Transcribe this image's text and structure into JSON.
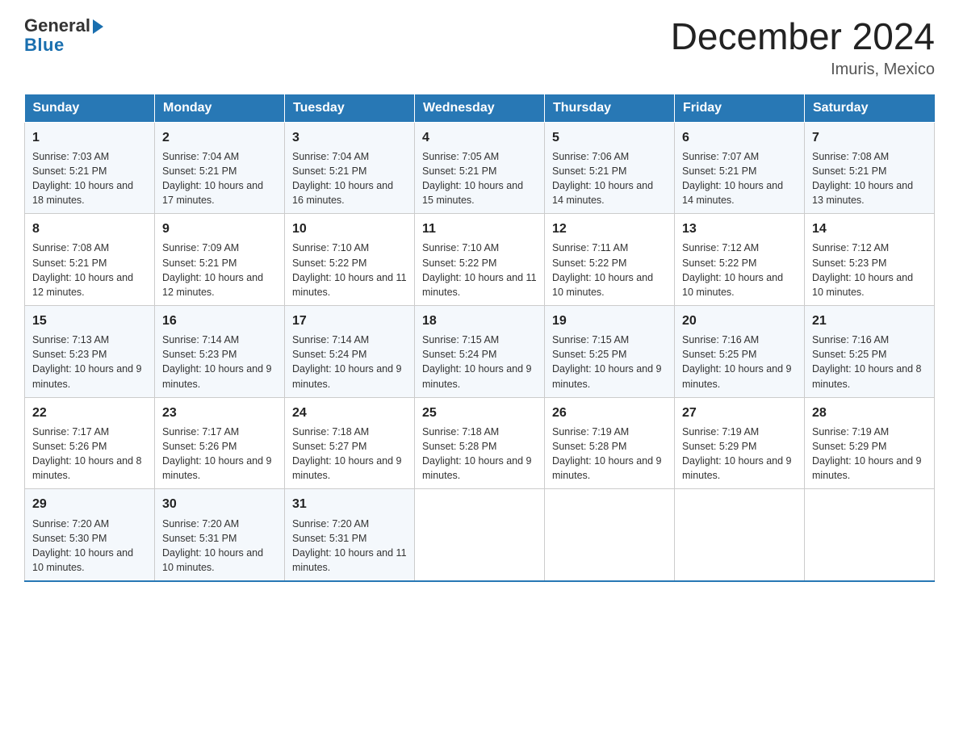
{
  "header": {
    "logo_text_general": "General",
    "logo_text_blue": "Blue",
    "month_title": "December 2024",
    "location": "Imuris, Mexico"
  },
  "days_of_week": [
    "Sunday",
    "Monday",
    "Tuesday",
    "Wednesday",
    "Thursday",
    "Friday",
    "Saturday"
  ],
  "weeks": [
    [
      {
        "day": "1",
        "sunrise": "Sunrise: 7:03 AM",
        "sunset": "Sunset: 5:21 PM",
        "daylight": "Daylight: 10 hours and 18 minutes."
      },
      {
        "day": "2",
        "sunrise": "Sunrise: 7:04 AM",
        "sunset": "Sunset: 5:21 PM",
        "daylight": "Daylight: 10 hours and 17 minutes."
      },
      {
        "day": "3",
        "sunrise": "Sunrise: 7:04 AM",
        "sunset": "Sunset: 5:21 PM",
        "daylight": "Daylight: 10 hours and 16 minutes."
      },
      {
        "day": "4",
        "sunrise": "Sunrise: 7:05 AM",
        "sunset": "Sunset: 5:21 PM",
        "daylight": "Daylight: 10 hours and 15 minutes."
      },
      {
        "day": "5",
        "sunrise": "Sunrise: 7:06 AM",
        "sunset": "Sunset: 5:21 PM",
        "daylight": "Daylight: 10 hours and 14 minutes."
      },
      {
        "day": "6",
        "sunrise": "Sunrise: 7:07 AM",
        "sunset": "Sunset: 5:21 PM",
        "daylight": "Daylight: 10 hours and 14 minutes."
      },
      {
        "day": "7",
        "sunrise": "Sunrise: 7:08 AM",
        "sunset": "Sunset: 5:21 PM",
        "daylight": "Daylight: 10 hours and 13 minutes."
      }
    ],
    [
      {
        "day": "8",
        "sunrise": "Sunrise: 7:08 AM",
        "sunset": "Sunset: 5:21 PM",
        "daylight": "Daylight: 10 hours and 12 minutes."
      },
      {
        "day": "9",
        "sunrise": "Sunrise: 7:09 AM",
        "sunset": "Sunset: 5:21 PM",
        "daylight": "Daylight: 10 hours and 12 minutes."
      },
      {
        "day": "10",
        "sunrise": "Sunrise: 7:10 AM",
        "sunset": "Sunset: 5:22 PM",
        "daylight": "Daylight: 10 hours and 11 minutes."
      },
      {
        "day": "11",
        "sunrise": "Sunrise: 7:10 AM",
        "sunset": "Sunset: 5:22 PM",
        "daylight": "Daylight: 10 hours and 11 minutes."
      },
      {
        "day": "12",
        "sunrise": "Sunrise: 7:11 AM",
        "sunset": "Sunset: 5:22 PM",
        "daylight": "Daylight: 10 hours and 10 minutes."
      },
      {
        "day": "13",
        "sunrise": "Sunrise: 7:12 AM",
        "sunset": "Sunset: 5:22 PM",
        "daylight": "Daylight: 10 hours and 10 minutes."
      },
      {
        "day": "14",
        "sunrise": "Sunrise: 7:12 AM",
        "sunset": "Sunset: 5:23 PM",
        "daylight": "Daylight: 10 hours and 10 minutes."
      }
    ],
    [
      {
        "day": "15",
        "sunrise": "Sunrise: 7:13 AM",
        "sunset": "Sunset: 5:23 PM",
        "daylight": "Daylight: 10 hours and 9 minutes."
      },
      {
        "day": "16",
        "sunrise": "Sunrise: 7:14 AM",
        "sunset": "Sunset: 5:23 PM",
        "daylight": "Daylight: 10 hours and 9 minutes."
      },
      {
        "day": "17",
        "sunrise": "Sunrise: 7:14 AM",
        "sunset": "Sunset: 5:24 PM",
        "daylight": "Daylight: 10 hours and 9 minutes."
      },
      {
        "day": "18",
        "sunrise": "Sunrise: 7:15 AM",
        "sunset": "Sunset: 5:24 PM",
        "daylight": "Daylight: 10 hours and 9 minutes."
      },
      {
        "day": "19",
        "sunrise": "Sunrise: 7:15 AM",
        "sunset": "Sunset: 5:25 PM",
        "daylight": "Daylight: 10 hours and 9 minutes."
      },
      {
        "day": "20",
        "sunrise": "Sunrise: 7:16 AM",
        "sunset": "Sunset: 5:25 PM",
        "daylight": "Daylight: 10 hours and 9 minutes."
      },
      {
        "day": "21",
        "sunrise": "Sunrise: 7:16 AM",
        "sunset": "Sunset: 5:25 PM",
        "daylight": "Daylight: 10 hours and 8 minutes."
      }
    ],
    [
      {
        "day": "22",
        "sunrise": "Sunrise: 7:17 AM",
        "sunset": "Sunset: 5:26 PM",
        "daylight": "Daylight: 10 hours and 8 minutes."
      },
      {
        "day": "23",
        "sunrise": "Sunrise: 7:17 AM",
        "sunset": "Sunset: 5:26 PM",
        "daylight": "Daylight: 10 hours and 9 minutes."
      },
      {
        "day": "24",
        "sunrise": "Sunrise: 7:18 AM",
        "sunset": "Sunset: 5:27 PM",
        "daylight": "Daylight: 10 hours and 9 minutes."
      },
      {
        "day": "25",
        "sunrise": "Sunrise: 7:18 AM",
        "sunset": "Sunset: 5:28 PM",
        "daylight": "Daylight: 10 hours and 9 minutes."
      },
      {
        "day": "26",
        "sunrise": "Sunrise: 7:19 AM",
        "sunset": "Sunset: 5:28 PM",
        "daylight": "Daylight: 10 hours and 9 minutes."
      },
      {
        "day": "27",
        "sunrise": "Sunrise: 7:19 AM",
        "sunset": "Sunset: 5:29 PM",
        "daylight": "Daylight: 10 hours and 9 minutes."
      },
      {
        "day": "28",
        "sunrise": "Sunrise: 7:19 AM",
        "sunset": "Sunset: 5:29 PM",
        "daylight": "Daylight: 10 hours and 9 minutes."
      }
    ],
    [
      {
        "day": "29",
        "sunrise": "Sunrise: 7:20 AM",
        "sunset": "Sunset: 5:30 PM",
        "daylight": "Daylight: 10 hours and 10 minutes."
      },
      {
        "day": "30",
        "sunrise": "Sunrise: 7:20 AM",
        "sunset": "Sunset: 5:31 PM",
        "daylight": "Daylight: 10 hours and 10 minutes."
      },
      {
        "day": "31",
        "sunrise": "Sunrise: 7:20 AM",
        "sunset": "Sunset: 5:31 PM",
        "daylight": "Daylight: 10 hours and 11 minutes."
      },
      {
        "day": "",
        "sunrise": "",
        "sunset": "",
        "daylight": ""
      },
      {
        "day": "",
        "sunrise": "",
        "sunset": "",
        "daylight": ""
      },
      {
        "day": "",
        "sunrise": "",
        "sunset": "",
        "daylight": ""
      },
      {
        "day": "",
        "sunrise": "",
        "sunset": "",
        "daylight": ""
      }
    ]
  ]
}
